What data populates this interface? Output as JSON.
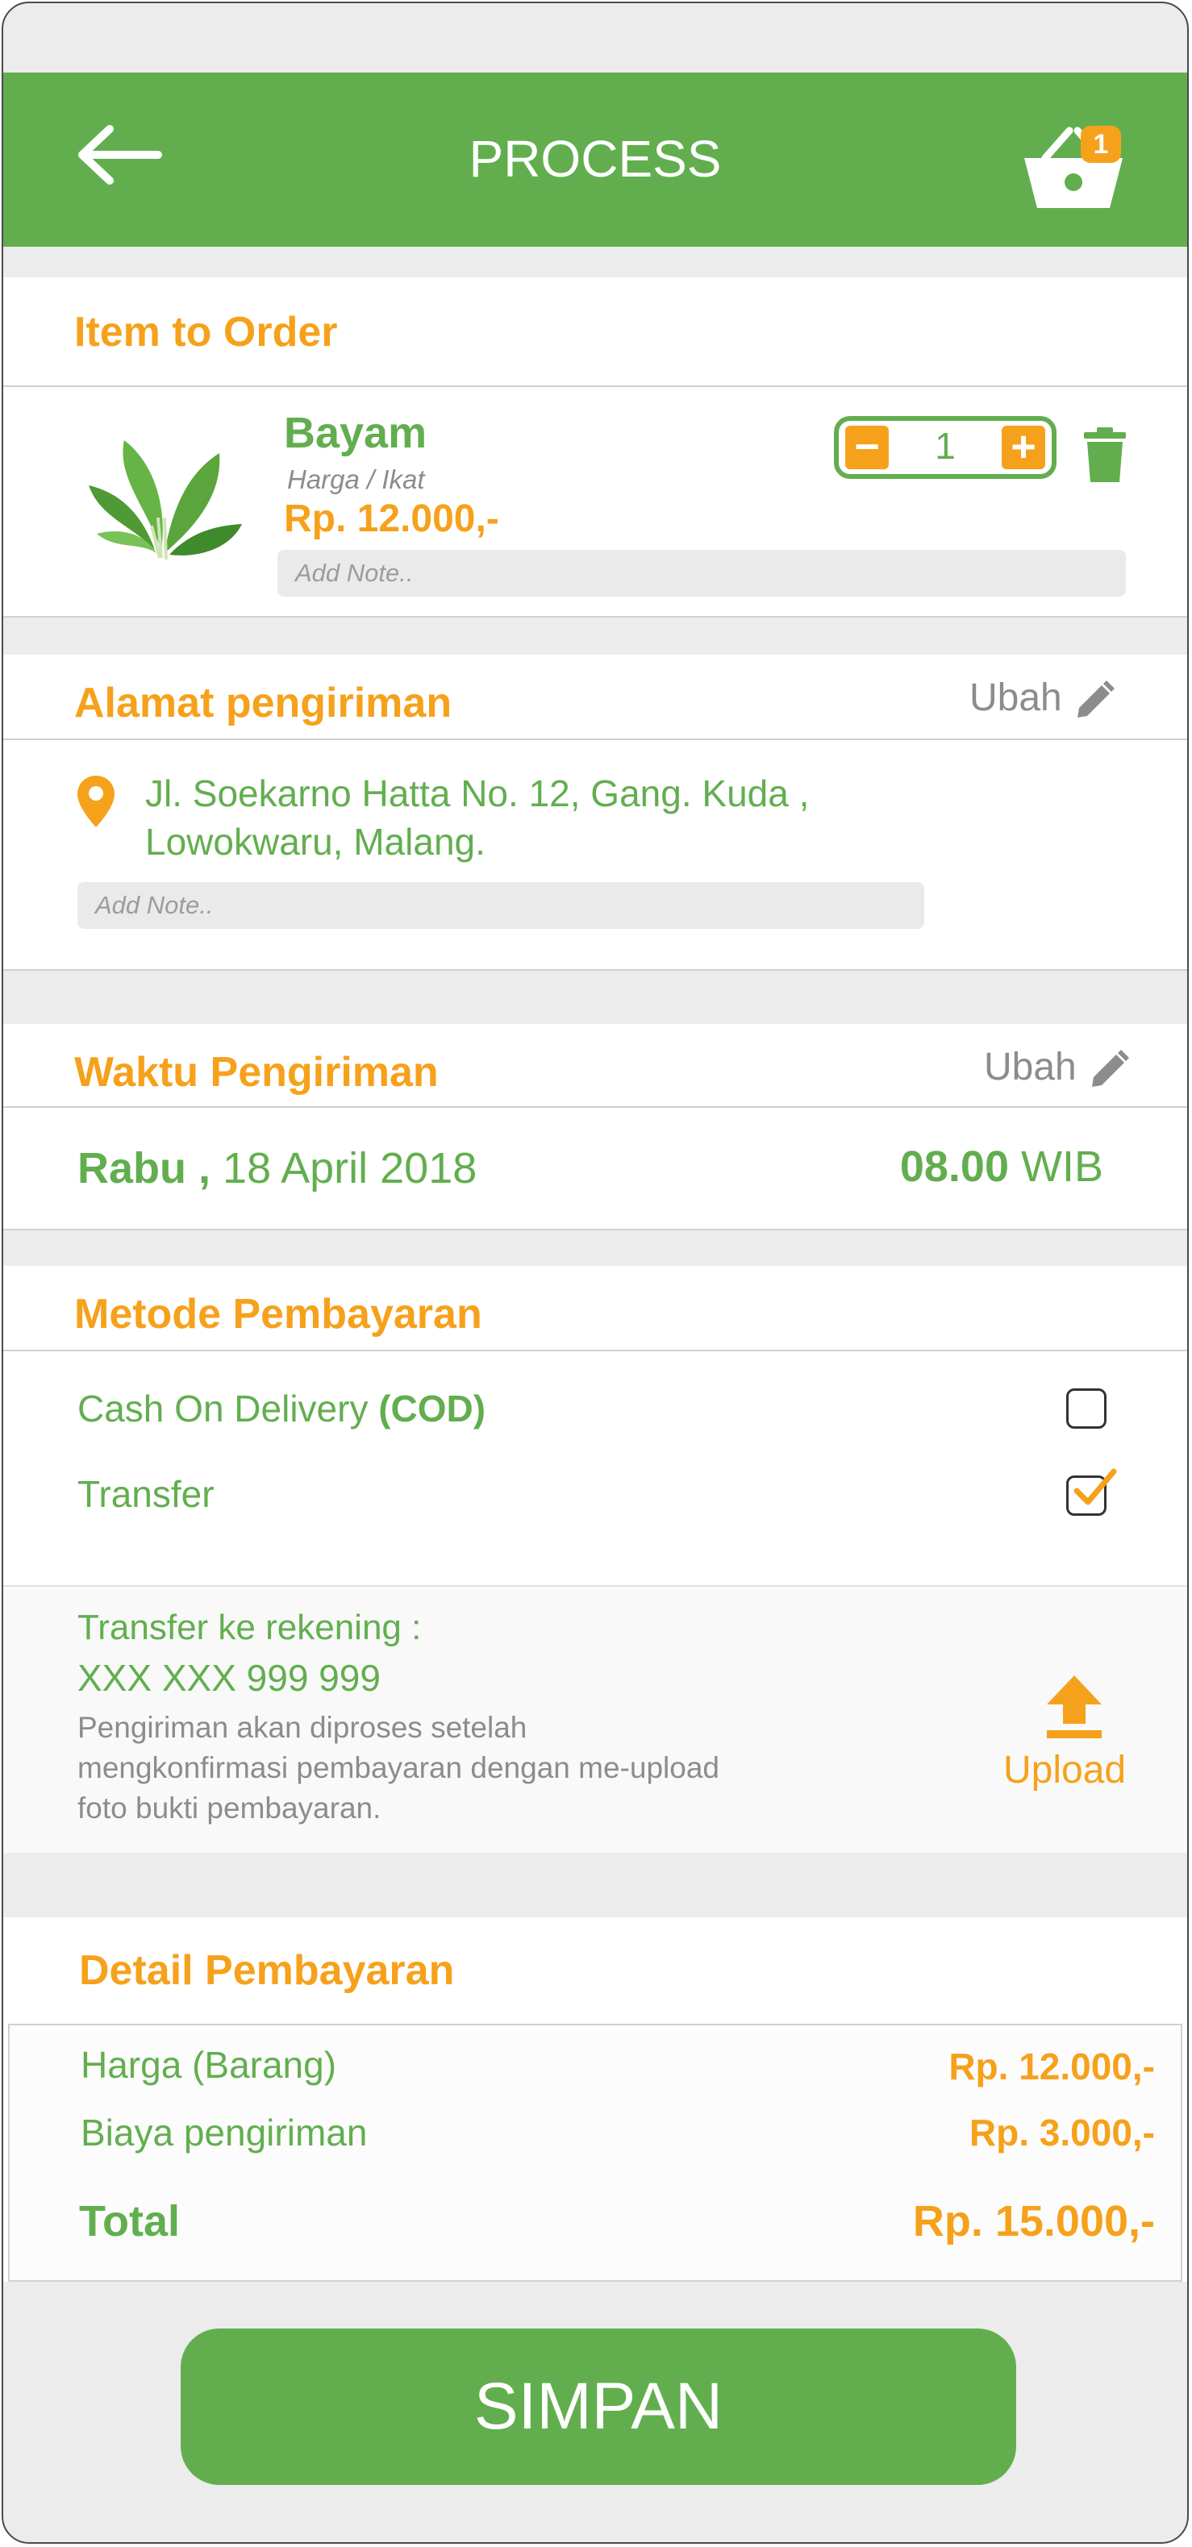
{
  "header": {
    "title": "PROCESS",
    "cart_count": "1",
    "back_icon": "arrow-left-icon",
    "cart_icon": "basket-icon"
  },
  "order": {
    "section_title": "Item to Order",
    "item": {
      "name": "Bayam",
      "unit": "Harga / Ikat",
      "price": "Rp. 12.000,-",
      "note_placeholder": "Add Note..",
      "quantity": "1",
      "minus": "−",
      "plus": "+"
    }
  },
  "address": {
    "section_title": "Alamat pengiriman",
    "edit_label": "Ubah",
    "line1": "Jl. Soekarno Hatta No. 12, Gang. Kuda ,",
    "line2": "Lowokwaru, Malang.",
    "note_placeholder": "Add Note.."
  },
  "delivery_time": {
    "section_title": "Waktu Pengiriman",
    "edit_label": "Ubah",
    "day": "Rabu ,",
    "date": "18 April 2018",
    "time": "08.00",
    "time_zone": "WIB"
  },
  "payment_method": {
    "section_title": "Metode Pembayaran",
    "options": [
      {
        "label": "Cash On Delivery",
        "label_bold": "(COD)",
        "checked": false
      },
      {
        "label": "Transfer",
        "label_bold": "",
        "checked": true
      }
    ]
  },
  "transfer_info": {
    "title": "Transfer ke rekening :",
    "account": "XXX XXX 999 999",
    "desc_line1": "Pengiriman akan diproses setelah",
    "desc_line2": "mengkonfirmasi pembayaran dengan me-upload",
    "desc_line3": "foto bukti pembayaran.",
    "upload_label": "Upload",
    "upload_icon": "upload-icon"
  },
  "payment_detail": {
    "section_title": "Detail Pembayaran",
    "rows": [
      {
        "label": "Harga (Barang)",
        "value": "Rp. 12.000,-"
      },
      {
        "label": "Biaya pengiriman",
        "value": "Rp. 3.000,-"
      }
    ],
    "total_label": "Total",
    "total_value": "Rp. 15.000,-"
  },
  "actions": {
    "save_label": "SIMPAN"
  },
  "colors": {
    "primary": "#62ae4f",
    "accent": "#f6a11c",
    "background": "#ececec"
  }
}
